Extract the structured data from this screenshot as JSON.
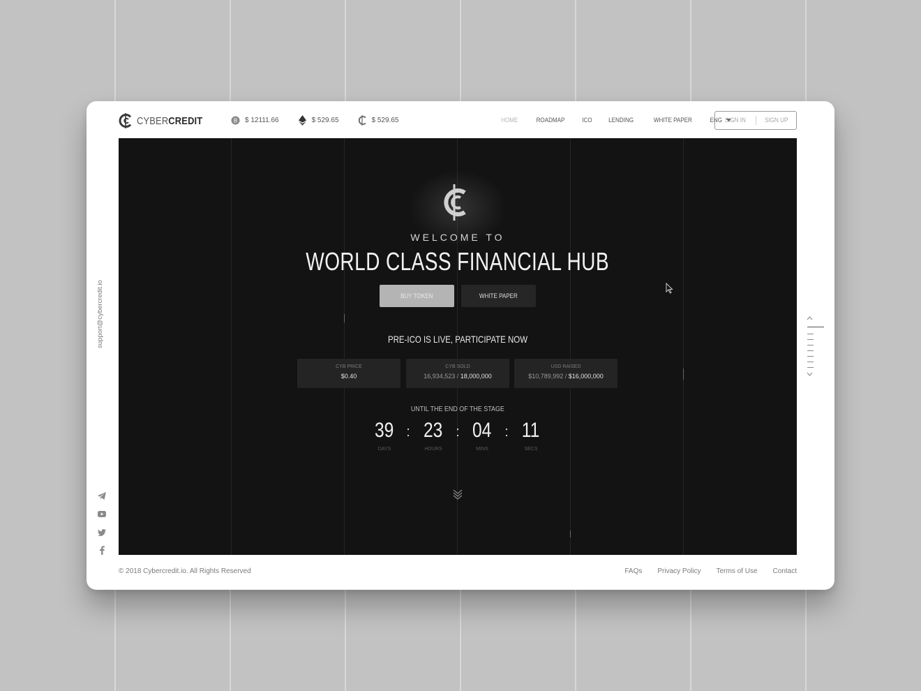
{
  "brand": {
    "name_light": "CYBER",
    "name_bold": "CREDIT"
  },
  "tickers": [
    {
      "icon": "bitcoin-icon",
      "price": "$ 12111.66"
    },
    {
      "icon": "ethereum-icon",
      "price": "$ 529.65"
    },
    {
      "icon": "cybercredit-icon",
      "price": "$ 529.65"
    }
  ],
  "nav": {
    "items": [
      "HOME",
      "ROADMAP",
      "ICO",
      "LENDING",
      "WHITE PAPER"
    ],
    "active": "HOME",
    "language": "ENG"
  },
  "auth": {
    "sign_in": "SIGN IN",
    "sign_up": "SIGN UP"
  },
  "hero": {
    "welcome": "WELCOME TO",
    "headline": "WORLD CLASS FINANCIAL HUB",
    "buy_token": "BUY TOKEN",
    "white_paper": "WHITE PAPER",
    "preico": "PRE-ICO IS LIVE, PARTICIPATE NOW",
    "stats": [
      {
        "label": "CYB PRICE",
        "value": "",
        "value_strong": "$0.40"
      },
      {
        "label": "CYB SOLD",
        "value": "16,934,523 / ",
        "value_strong": "18,000,000"
      },
      {
        "label": "USD RAISED",
        "value": "$10,789,992 / ",
        "value_strong": "$16,000,000"
      }
    ],
    "until": "UNTIL THE END OF THE STAGE",
    "countdown": [
      {
        "value": "39",
        "label": "DAYS"
      },
      {
        "value": "23",
        "label": "HOURS"
      },
      {
        "value": "04",
        "label": "MINS"
      },
      {
        "value": "11",
        "label": "SECS"
      }
    ],
    "separator": ":"
  },
  "side": {
    "email": "support@cybercredit.io",
    "socials": [
      "telegram-icon",
      "youtube-icon",
      "twitter-icon",
      "facebook-icon"
    ],
    "pager_current": 1
  },
  "footer": {
    "copyright": "© 2018 Cybercredit.io. All Rights Reserved",
    "links": [
      "FAQs",
      "Privacy Policy",
      "Terms of Use",
      "Contact"
    ]
  },
  "colors": {
    "hero_bg": "#131313",
    "frame_bg": "#ffffff",
    "page_bg": "#c2c2c2",
    "primary_button": "#b4b4b4"
  }
}
